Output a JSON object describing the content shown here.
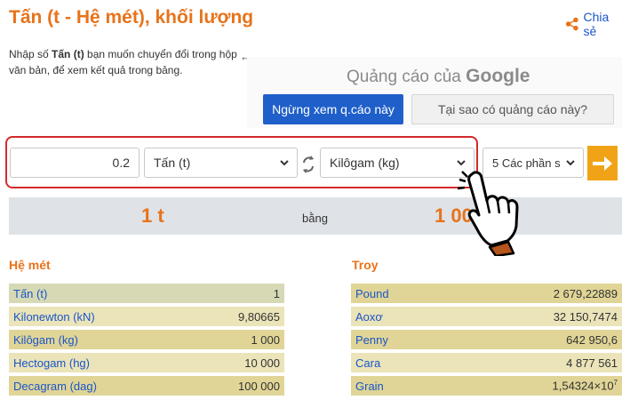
{
  "header": {
    "title": "Tấn (t - Hệ mét), khối lượng",
    "share_label": "Chia sẻ"
  },
  "intro": {
    "text_before": "Nhập số ",
    "bold_unit": "Tấn (t)",
    "text_after": " bạn muốn chuyển đổi trong hộp văn bản, để xem kết quả trong bảng."
  },
  "ad": {
    "line_prefix": "Quảng cáo của",
    "brand": "Google",
    "stop_button": "Ngừng xem q.cáo này",
    "why_button": "Tại sao có quảng cáo này?"
  },
  "converter": {
    "value": "0.2",
    "from_unit": "Tấn (t)",
    "to_unit": "Kilôgam (kg)",
    "precision": "5 Các phần s",
    "go_icon": "arrow-right-icon",
    "swap_icon": "swap-icon"
  },
  "result": {
    "left": "1 t",
    "middle": "bằng",
    "right": "1 00   g"
  },
  "metric": {
    "heading": "Hệ mét",
    "rows": [
      {
        "label": "Tấn (t)",
        "value": "1"
      },
      {
        "label": "Kilonewton (kN)",
        "value": "9,80665"
      },
      {
        "label": "Kilôgam (kg)",
        "value": "1 000"
      },
      {
        "label": "Hectogam (hg)",
        "value": "10 000"
      },
      {
        "label": "Decagram (dag)",
        "value": "100 000"
      }
    ]
  },
  "troy": {
    "heading": "Troy",
    "rows": [
      {
        "label": "Pound",
        "value": "2 679,22889"
      },
      {
        "label": "Aoxơ",
        "value": "32 150,7474"
      },
      {
        "label": "Penny",
        "value": "642 950,6"
      },
      {
        "label": "Cara",
        "value": "4 877 561"
      },
      {
        "label": "Grain",
        "value": "1,54324×10",
        "exp": "7"
      }
    ]
  },
  "colors": {
    "accent": "#e8731b",
    "link": "#1a55c9",
    "highlight_border": "#d42a2a",
    "go_button": "#f1a317",
    "ad_button": "#1f5fc9"
  }
}
